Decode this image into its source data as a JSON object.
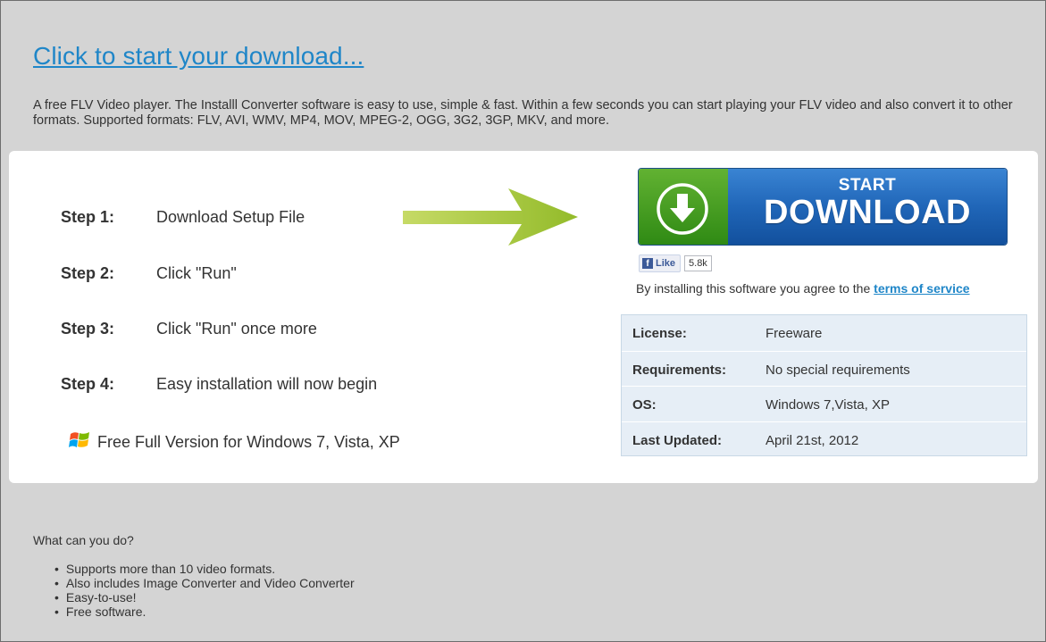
{
  "headline": "Click to start your download...",
  "intro": "A free FLV Video player. The Installl Converter software is easy to use, simple & fast. Within a few seconds you can start playing your FLV video and also convert it to other formats. Supported formats: FLV, AVI, WMV, MP4, MOV, MPEG-2, OGG, 3G2, 3GP, MKV, and more.",
  "steps": [
    {
      "num": "Step 1:",
      "text": "Download Setup File"
    },
    {
      "num": "Step 2:",
      "text": "Click \"Run\""
    },
    {
      "num": "Step 3:",
      "text": "Click \"Run\" once more"
    },
    {
      "num": "Step 4:",
      "text": "Easy installation will now begin"
    }
  ],
  "win_note": "Free Full Version for Windows 7, Vista, XP",
  "download_button": {
    "top": "START",
    "main": "DOWNLOAD"
  },
  "like": {
    "label": "Like",
    "count": "5.8k"
  },
  "agree": {
    "prefix": "By installing this software you agree to the ",
    "link": "terms of service"
  },
  "info": [
    {
      "key": "License:",
      "value": "Freeware"
    },
    {
      "key": "Requirements:",
      "value": "No special requirements"
    },
    {
      "key": "OS:",
      "value": "Windows 7,Vista, XP"
    },
    {
      "key": "Last Updated:",
      "value": "April 21st, 2012"
    }
  ],
  "what_heading": "What can you do?",
  "features": [
    "Supports more than 10 video formats.",
    "Also includes Image Converter and Video Converter",
    "Easy-to-use!",
    "Free software."
  ],
  "colors": {
    "link": "#1f86c8",
    "button_green": "#4a9e24",
    "button_blue": "#2066b8",
    "arrow": "#a8c93a"
  }
}
